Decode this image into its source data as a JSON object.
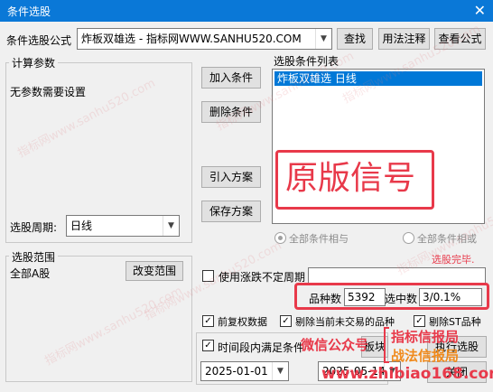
{
  "window": {
    "title": "条件选股",
    "close_glyph": "✕"
  },
  "formula": {
    "label": "条件选股公式",
    "value": "炸板双雄选  - 指标网WWW.SANHU520.COM",
    "find_button": "查找",
    "usage_button": "用法注释",
    "view_button": "查看公式"
  },
  "params": {
    "group_label": "计算参数",
    "empty_text": "无参数需要设置",
    "period_label": "选股周期:",
    "period_value": "日线"
  },
  "actions": {
    "add": "加入条件",
    "delete": "删除条件",
    "import": "引入方案",
    "save": "保存方案"
  },
  "conditions": {
    "label": "选股条件列表",
    "items": [
      "炸板双雄选  日线"
    ],
    "and_label": "全部条件相与",
    "or_label": "全部条件相或"
  },
  "range": {
    "group_label": "选股范围",
    "value": "全部A股",
    "change_button": "改变范围"
  },
  "status": {
    "text": "选股完毕.",
    "color": "#e8394a"
  },
  "options": {
    "indefinite_label": "使用涨跌不定周期",
    "count_label": "品种数",
    "count_value": "5392",
    "selected_label": "选中数",
    "selected_value": "3/0.1%",
    "pre_adjust": "前复权数据",
    "exclude_untraded": "剔除当前未交易的品种",
    "exclude_st": "剔除ST品种",
    "time_range_label": "时间段内满足条件",
    "start_date": "2025-01-01",
    "end_date": "2025-05-14",
    "board_btn": "板块",
    "exec_btn": "执行选股",
    "close_btn": "关闭"
  },
  "overlays": {
    "banner": "原版信号",
    "wechat": "微信公众号",
    "stamp_line1": "指标信报局",
    "stamp_line2": "战法信报局",
    "site": "www.zhibiao168.com"
  },
  "watermarks": [
    "指标网www.sanhu520.com",
    "指标网www.sanhu520.com",
    "指标网www.sanhu520.com",
    "指标网www.sanhu520.com",
    "指标网www.sanhu520.com",
    "指标网www.sanhu520.com"
  ],
  "colors": {
    "accent": "#0078d7",
    "titlebar": "#0a78d7",
    "highlight": "#e8394a"
  }
}
